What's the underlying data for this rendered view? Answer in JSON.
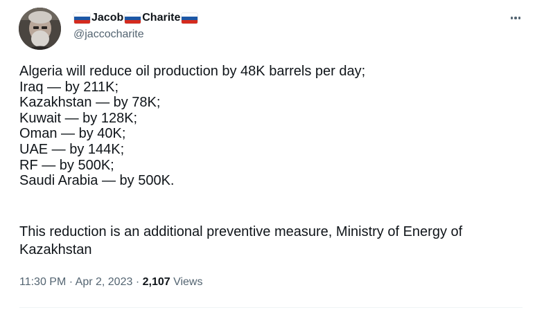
{
  "author": {
    "name_part1": "Jacob",
    "name_part2": "Charite",
    "handle": "@jaccocharite",
    "flag_colors": [
      "#ffffff",
      "#1c57a5",
      "#d52b1e"
    ]
  },
  "tweet": {
    "lines": [
      "Algeria will reduce oil production by 48K barrels per day;",
      "Iraq — by 211K;",
      "Kazakhstan — by 78K;",
      "Kuwait — by 128K;",
      "Oman — by 40K;",
      "UAE — by 144K;",
      "RF — by 500K;",
      "Saudi Arabia — by 500K."
    ],
    "paragraph2": "This reduction is an additional preventive measure, Ministry of Energy of Kazakhstan"
  },
  "meta": {
    "time": "11:30 PM",
    "separator": "·",
    "date": "Apr 2, 2023",
    "views_count": "2,107",
    "views_label": "Views"
  },
  "icons": {
    "more": "more-options-icon"
  }
}
